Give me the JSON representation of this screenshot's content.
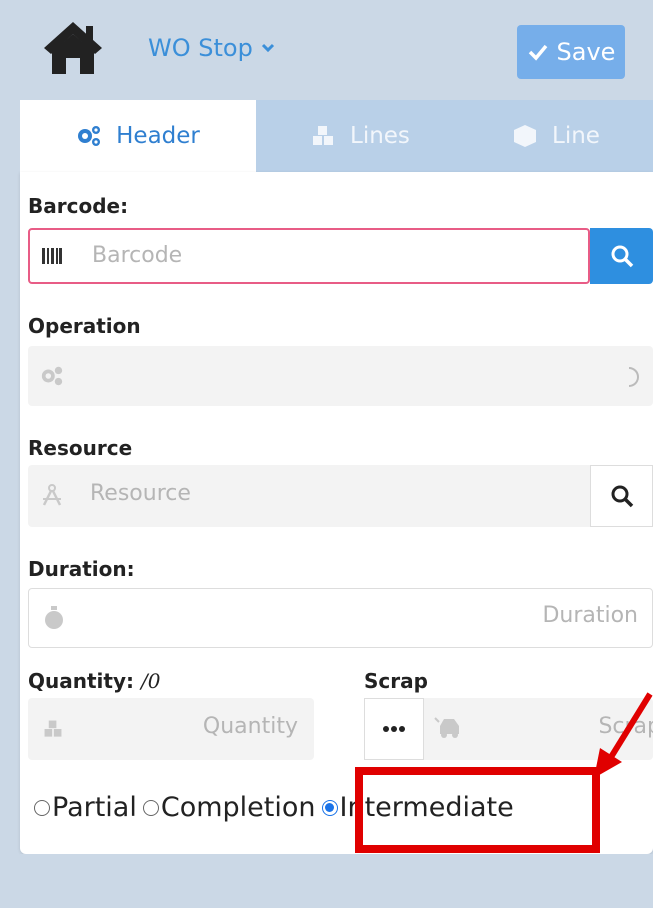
{
  "header": {
    "title": "WO Stop",
    "save_label": "Save"
  },
  "tabs": [
    {
      "label": "Header",
      "icon": "gears-icon",
      "active": true
    },
    {
      "label": "Lines",
      "icon": "cubes-icon",
      "active": false
    },
    {
      "label": "Line",
      "icon": "cube-icon",
      "active": false
    }
  ],
  "form": {
    "barcode": {
      "label": "Barcode:",
      "placeholder": "Barcode"
    },
    "operation": {
      "label": "Operation"
    },
    "resource": {
      "label": "Resource",
      "placeholder": "Resource"
    },
    "duration": {
      "label": "Duration:",
      "placeholder": "Duration"
    },
    "quantity": {
      "label": "Quantity:",
      "suffix": "/0",
      "placeholder": "Quantity"
    },
    "scrap": {
      "label": "Scrap",
      "placeholder": "Scrap"
    },
    "confirmation_type": {
      "options": [
        "Partial",
        "Completion",
        "Intermediate"
      ],
      "selected": "Intermediate"
    }
  },
  "colors": {
    "accent": "#3b8fd9",
    "save_bg": "#76aeea",
    "annotation": "#e00000"
  }
}
